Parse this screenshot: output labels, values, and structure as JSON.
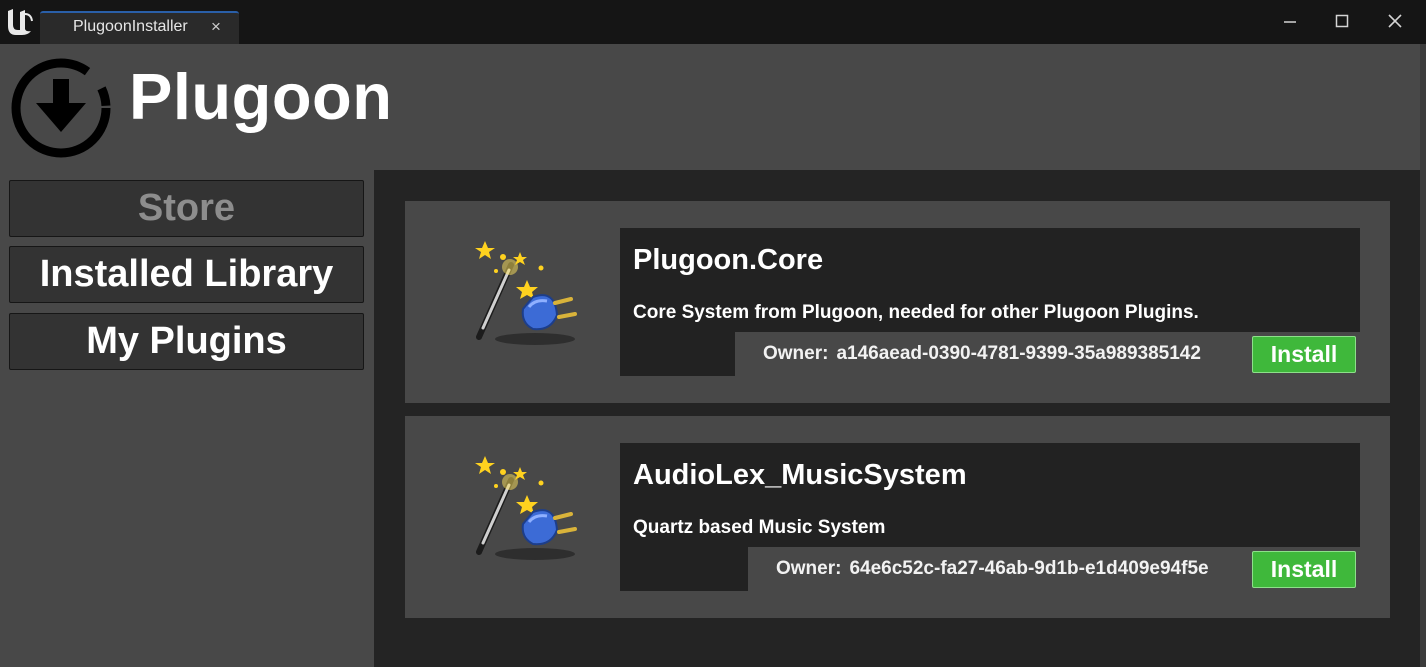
{
  "window": {
    "tab_label": "PlugoonInstaller",
    "tab_close": "×"
  },
  "header": {
    "title": "Plugoon"
  },
  "sidebar": {
    "items": [
      {
        "label": "Store",
        "state": "disabled"
      },
      {
        "label": "Installed Library"
      },
      {
        "label": "My Plugins"
      }
    ]
  },
  "plugins": [
    {
      "name": "Plugoon.Core",
      "description": "Core System from Plugoon, needed for other Plugoon Plugins.",
      "owner_label": "Owner:",
      "owner_id": "a146aead-0390-4781-9399-35a989385142",
      "action_label": "Install",
      "icon": "magic-wand-plug-icon"
    },
    {
      "name": "AudioLex_MusicSystem",
      "description": "Quartz based Music System",
      "owner_label": "Owner:",
      "owner_id": "64e6c52c-fa27-46ab-9d1b-e1d409e94f5e",
      "action_label": "Install",
      "icon": "magic-wand-plug-icon"
    }
  ],
  "colors": {
    "background": "#484848",
    "titlebar": "#151515",
    "panel": "#242424",
    "install_green": "#3fb83b"
  }
}
